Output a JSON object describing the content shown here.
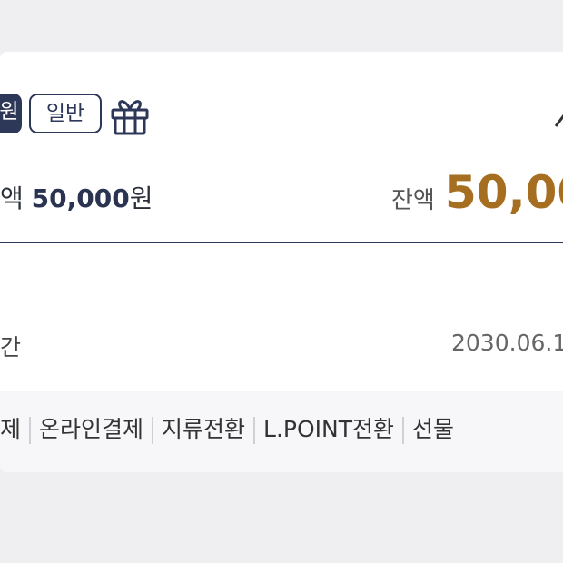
{
  "card": {
    "tags": {
      "filled": "원",
      "outline": "일반"
    },
    "icons": {
      "gift": "gift-icon",
      "caret": "chevron-up-icon"
    },
    "amount_label": "액",
    "amount_value": "50,000",
    "amount_unit": "원",
    "balance_label": "잔액",
    "balance_value": "50,00",
    "period_label": "간",
    "period_value": "2030.06.1",
    "usage_items": [
      "제",
      "온라인결제",
      "지류전환",
      "L.POINT전환",
      "선물"
    ]
  },
  "colors": {
    "navy": "#2d3757",
    "gold": "#a66e20",
    "background": "#efeff1",
    "card": "#ffffff",
    "usage_bar": "#f7f7f9"
  }
}
